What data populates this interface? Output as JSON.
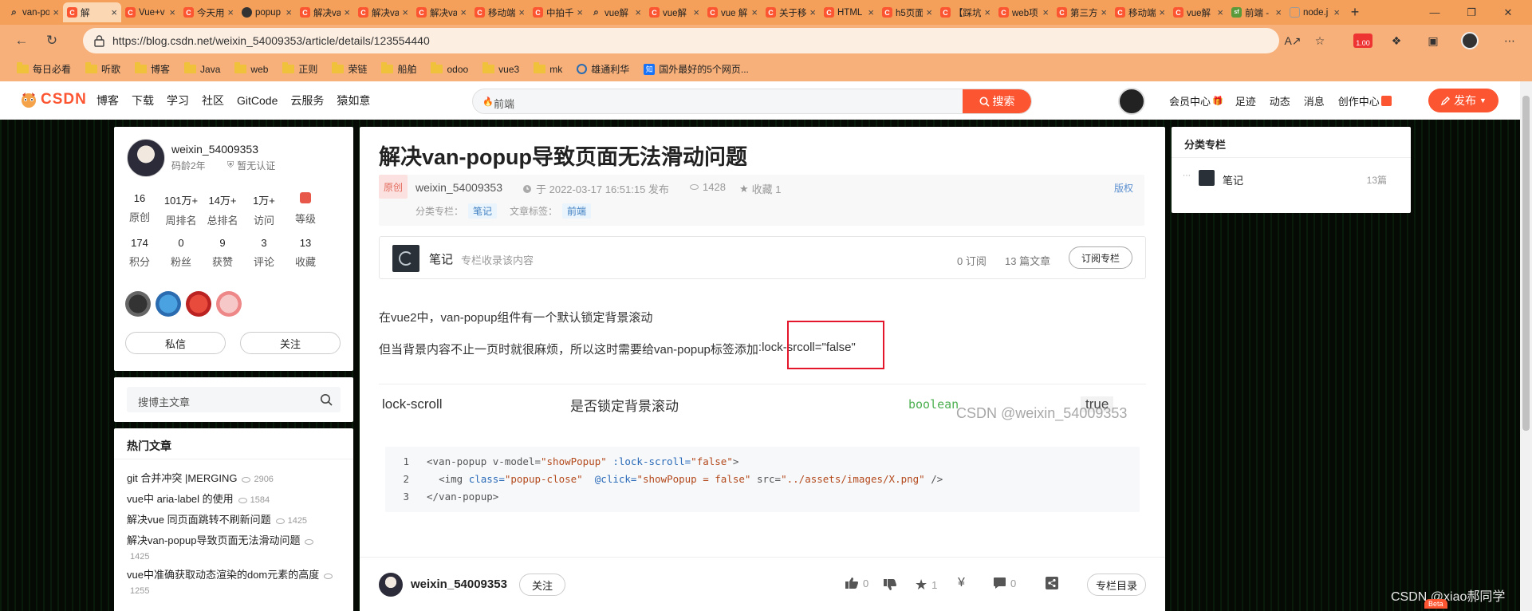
{
  "browser": {
    "tabs": [
      {
        "label": "van-po",
        "fav": "search",
        "color": "#555"
      },
      {
        "label": "解",
        "fav": "C",
        "color": "#fc5531",
        "active": true
      },
      {
        "label": "Vue+v",
        "fav": "C",
        "color": "#fc5531"
      },
      {
        "label": "今天用",
        "fav": "C",
        "color": "#fc5531"
      },
      {
        "label": "popup",
        "fav": "gh",
        "color": "#333"
      },
      {
        "label": "解决va",
        "fav": "C",
        "color": "#fc5531"
      },
      {
        "label": "解决va",
        "fav": "C",
        "color": "#fc5531"
      },
      {
        "label": "解决va",
        "fav": "C",
        "color": "#fc5531"
      },
      {
        "label": "移动端",
        "fav": "C",
        "color": "#fc5531"
      },
      {
        "label": "中拍千",
        "fav": "C",
        "color": "#fc5531"
      },
      {
        "label": "vue解",
        "fav": "search",
        "color": "#555"
      },
      {
        "label": "vue解",
        "fav": "C",
        "color": "#fc5531"
      },
      {
        "label": "vue 解",
        "fav": "C",
        "color": "#fc5531"
      },
      {
        "label": "关于移",
        "fav": "C",
        "color": "#fc5531"
      },
      {
        "label": "HTML",
        "fav": "C",
        "color": "#fc5531"
      },
      {
        "label": "h5页面",
        "fav": "C",
        "color": "#fc5531"
      },
      {
        "label": "【踩坑",
        "fav": "C",
        "color": "#fc5531"
      },
      {
        "label": "web项",
        "fav": "C",
        "color": "#fc5531"
      },
      {
        "label": "第三方",
        "fav": "C",
        "color": "#fc5531"
      },
      {
        "label": "移动端",
        "fav": "C",
        "color": "#fc5531"
      },
      {
        "label": "vue解",
        "fav": "C",
        "color": "#fc5531"
      },
      {
        "label": "前端 -",
        "fav": "sf",
        "color": "#5b9a3a"
      },
      {
        "label": "node.j",
        "fav": "blank",
        "color": "#999"
      }
    ],
    "url": "https://blog.csdn.net/weixin_54009353/article/details/123554440",
    "reader_badge": "1.00",
    "bookmarks": [
      "每日必看",
      "听歌",
      "博客",
      "Java",
      "web",
      "正则",
      "荣链",
      "船舶",
      "odoo",
      "vue3",
      "mk",
      "雄通利华",
      "国外最好的5个网页..."
    ]
  },
  "csdn": {
    "logo": "CSDN",
    "nav": [
      "博客",
      "下载",
      "学习",
      "社区",
      "GitCode",
      "云服务",
      "猿如意"
    ],
    "search_placeholder": "前端",
    "search_button": "搜索",
    "right_nav": [
      "会员中心",
      "足迹",
      "动态",
      "消息",
      "创作中心"
    ],
    "publish": "发布"
  },
  "profile": {
    "name": "weixin_54009353",
    "age": "码龄2年",
    "cert": "暂无认证",
    "stats1": [
      {
        "n": "16",
        "l": "原创"
      },
      {
        "n": "101万+",
        "l": "周排名"
      },
      {
        "n": "14万+",
        "l": "总排名"
      },
      {
        "n": "1万+",
        "l": "访问"
      },
      {
        "n": "",
        "l": "等级"
      }
    ],
    "stats2": [
      {
        "n": "174",
        "l": "积分"
      },
      {
        "n": "0",
        "l": "粉丝"
      },
      {
        "n": "9",
        "l": "获赞"
      },
      {
        "n": "3",
        "l": "评论"
      },
      {
        "n": "13",
        "l": "收藏"
      }
    ],
    "btn_msg": "私信",
    "btn_follow": "关注"
  },
  "sidebar": {
    "search_placeholder": "搜博主文章",
    "hot_title": "热门文章",
    "hot": [
      {
        "title": "git 合并冲突 |MERGING",
        "views": "2906"
      },
      {
        "title": "vue中 aria-label 的使用",
        "views": "1584"
      },
      {
        "title": "解决vue 同页面跳转不刷新问题",
        "views": "1425"
      },
      {
        "title": "解决van-popup导致页面无法滑动问题",
        "views": "1425"
      },
      {
        "title": "vue中准确获取动态渲染的dom元素的高度",
        "views": "1255"
      }
    ]
  },
  "article": {
    "title": "解决van-popup导致页面无法滑动问题",
    "badge": "原创",
    "author": "weixin_54009353",
    "date": "于 2022-03-17 16:51:15 发布",
    "views": "1428",
    "collect": "收藏 1",
    "copyright": "版权",
    "column_label": "分类专栏：",
    "column_tag": "笔记",
    "tags_label": "文章标签：",
    "tag": "前端",
    "column_box": {
      "name": "笔记",
      "desc": "专栏收录该内容",
      "subs": "0 订阅",
      "count": "13 篇文章",
      "btn": "订阅专栏"
    },
    "p1": "在vue2中，van-popup组件有一个默认锁定背景滚动",
    "p2": "但当背景内容不止一页时就很麻烦，所以这时需要给van-popup标签添加",
    "p2_code": ":lock-srcoll=\"false\"",
    "table": {
      "name": "lock-scroll",
      "desc": "是否锁定背景滚动",
      "type": "boolean",
      "default": "true",
      "watermark": "CSDN @weixin_54009353"
    },
    "code_lines": [
      {
        "n": "1"
      },
      {
        "n": "2"
      },
      {
        "n": "3"
      }
    ]
  },
  "bottombar": {
    "author": "weixin_54009353",
    "follow": "关注",
    "likes": "0",
    "stars": "1",
    "comments": "0",
    "toc": "专栏目录"
  },
  "right": {
    "title": "分类专栏",
    "item": "笔记",
    "count": "13篇"
  },
  "watermark": "CSDN @xiao郝同学",
  "beta": "Beta"
}
